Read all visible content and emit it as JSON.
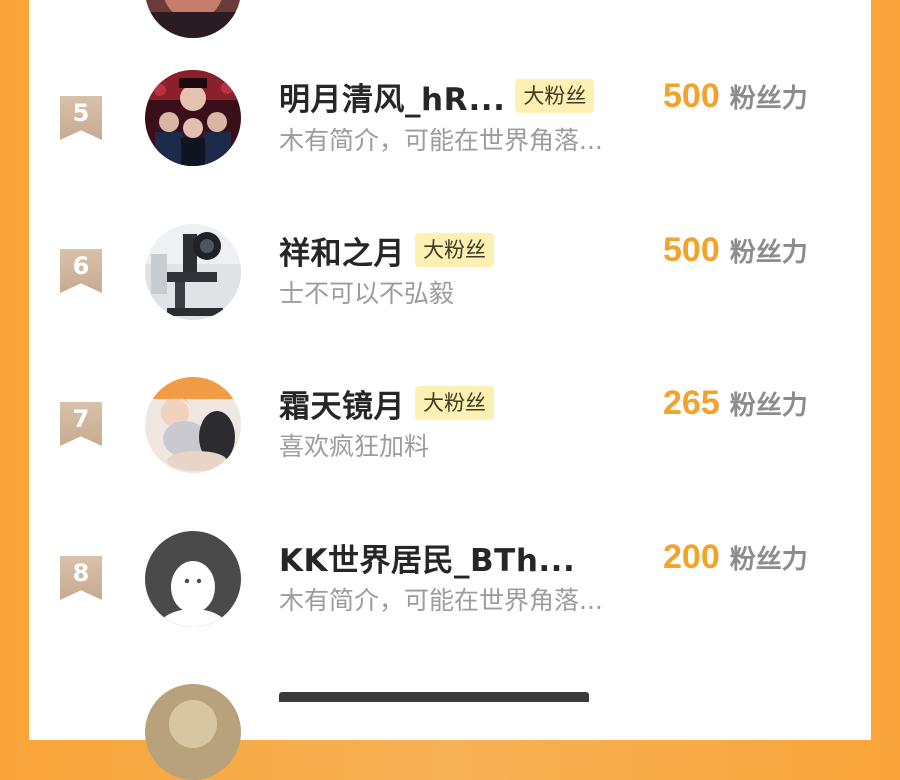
{
  "leaderboard": {
    "rows": [
      {
        "rank": "5",
        "name": "明月清风_hR...",
        "badge": "大粉丝",
        "bio": "木有简介，可能在世界角落...",
        "score": "500",
        "unit": "粉丝力",
        "avatar": "anime-group-avatar"
      },
      {
        "rank": "6",
        "name": "祥和之月",
        "badge": "大粉丝",
        "bio": "士不可以不弘毅",
        "score": "500",
        "unit": "粉丝力",
        "avatar": "microscope-avatar"
      },
      {
        "rank": "7",
        "name": "霜天镜月",
        "badge": "大粉丝",
        "bio": "喜欢疯狂加料",
        "score": "265",
        "unit": "粉丝力",
        "avatar": "anime-figure-avatar"
      },
      {
        "rank": "8",
        "name": "KK世界居民_BTh...",
        "badge": "",
        "bio": "木有简介，可能在世界角落...",
        "score": "200",
        "unit": "粉丝力",
        "avatar": "default-user-avatar"
      }
    ]
  },
  "colors": {
    "background": "#f9a438",
    "score": "#f2a32b",
    "badge_bg": "#fdf0b3",
    "rank_badge": "#d0b59c"
  }
}
